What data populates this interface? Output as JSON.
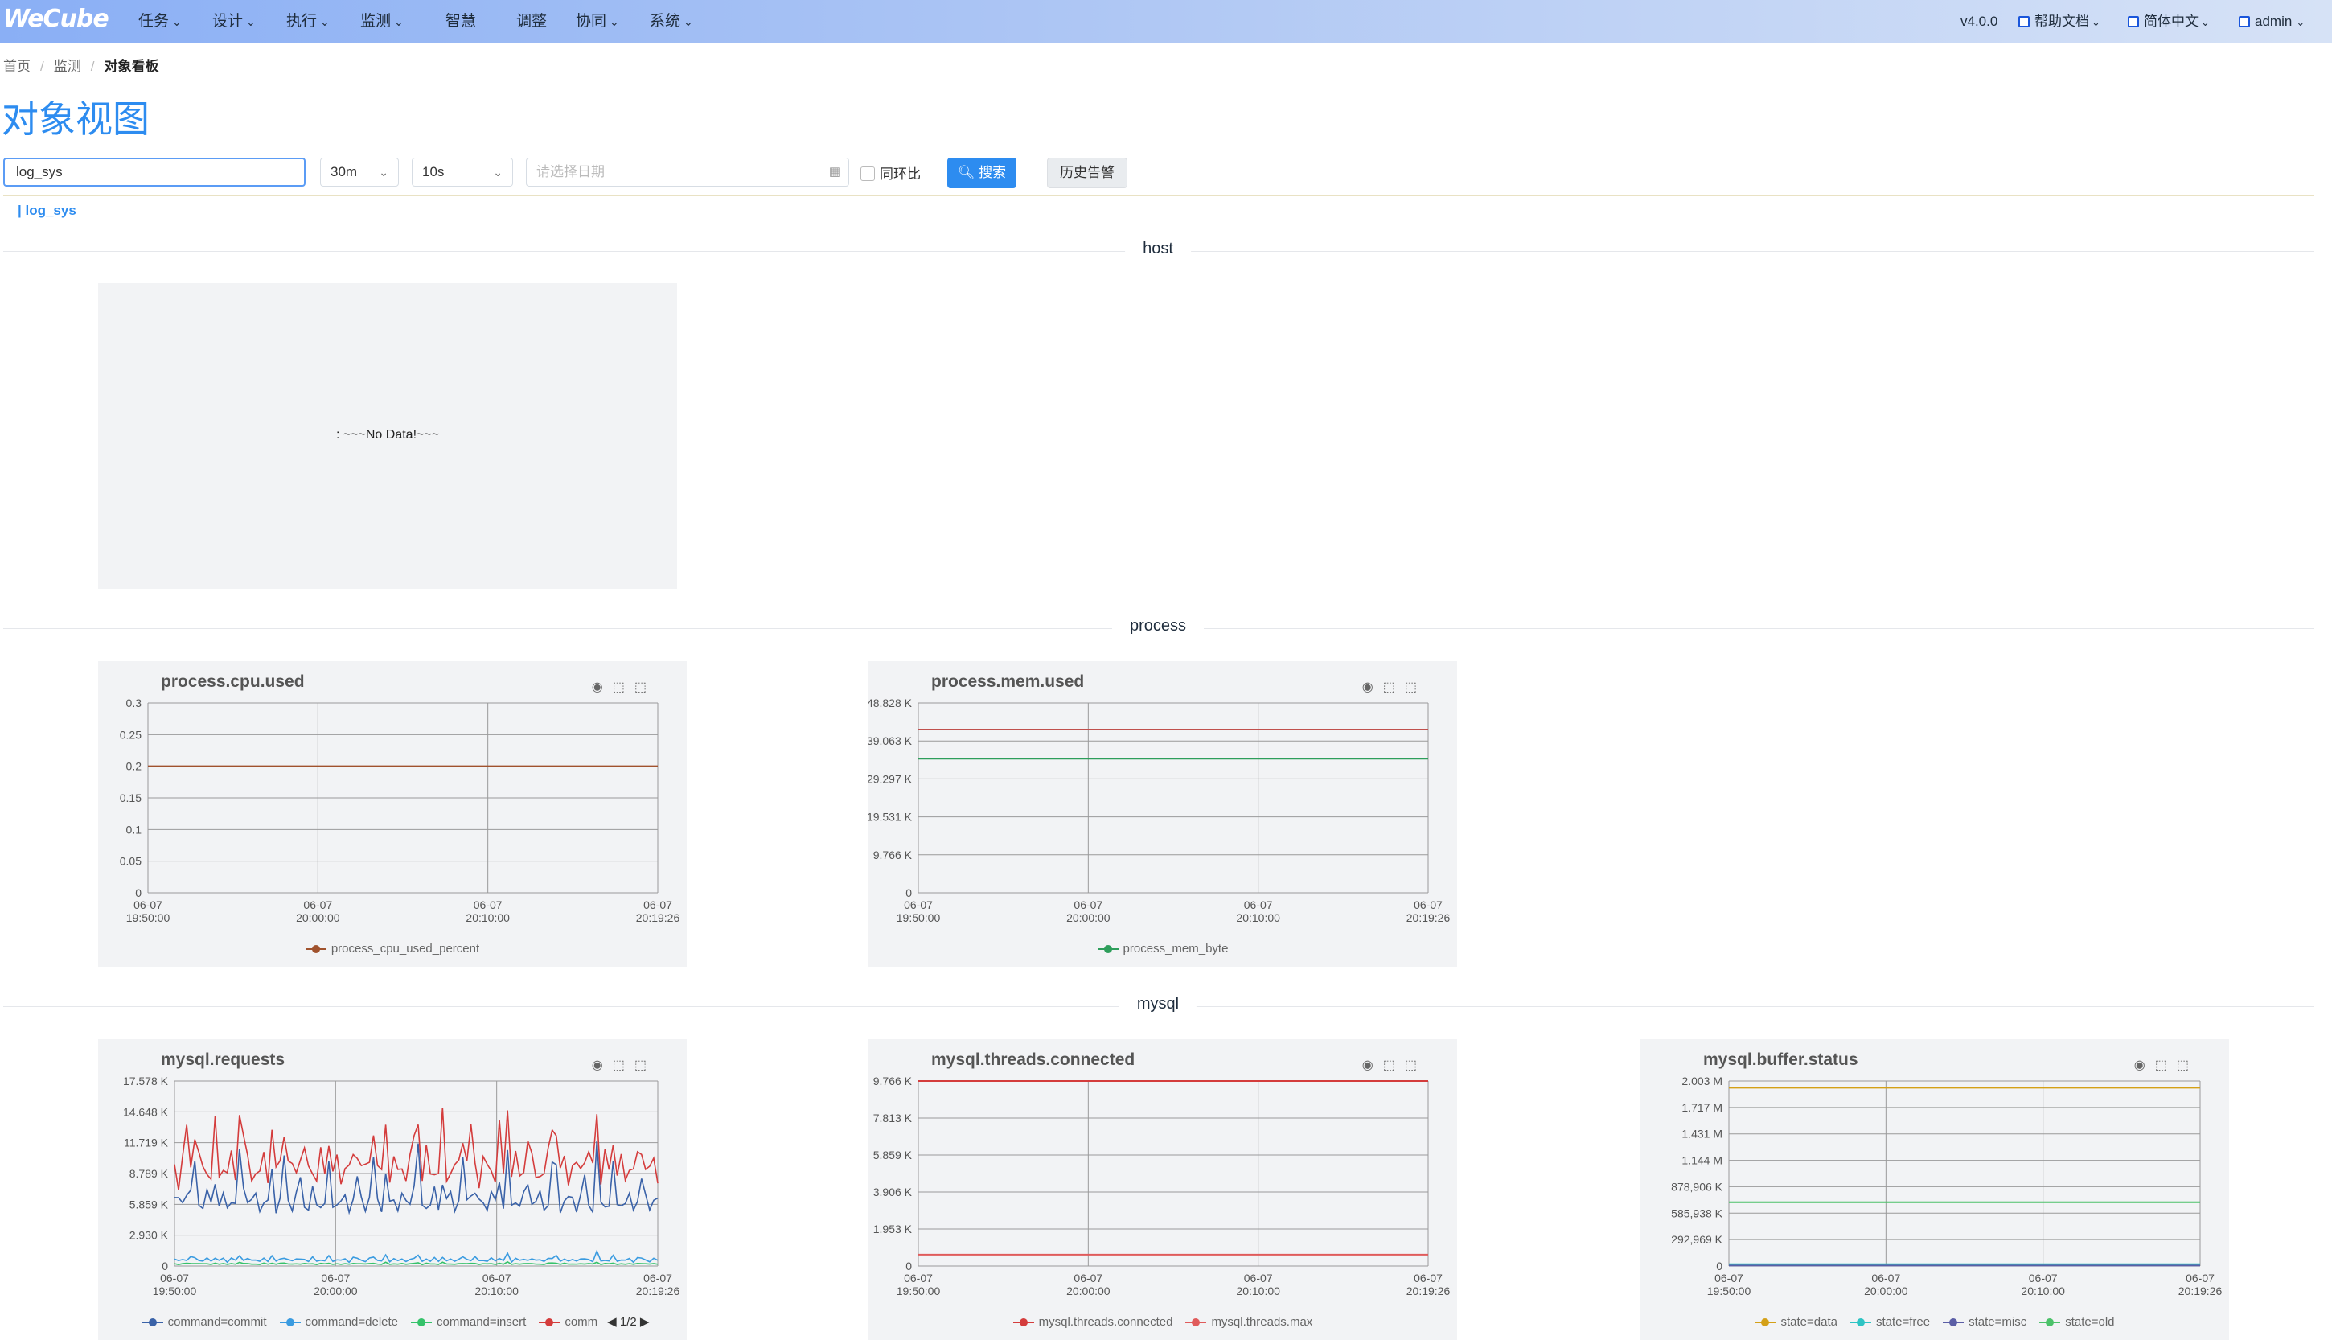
{
  "topbar": {
    "logo": "WeCube",
    "menus": [
      "任务",
      "设计",
      "执行",
      "监测",
      "智慧",
      "调整",
      "协同",
      "系统"
    ],
    "version": "v4.0.0",
    "help": "帮助文档",
    "language": "简体中文",
    "user": "admin"
  },
  "breadcrumb": {
    "home": "首页",
    "section": "监测",
    "current": "对象看板"
  },
  "page": {
    "title": "对象视图"
  },
  "filters": {
    "object": "log_sys",
    "range": "30m",
    "interval": "10s",
    "date_placeholder": "请选择日期",
    "compare_label": "同环比",
    "search_label": "搜索",
    "history_label": "历史告警"
  },
  "tag": "| log_sys",
  "groups": {
    "host": "host",
    "process": "process",
    "mysql": "mysql"
  },
  "no_data": ": ~~~No Data!~~~",
  "chart_data": [
    {
      "type": "line",
      "title": "process.cpu.used",
      "x": [
        "06-07\n19:50:00",
        "06-07\n20:00:00",
        "06-07\n20:10:00",
        "06-07\n20:19:26"
      ],
      "y_ticks": [
        "0",
        "0.05",
        "0.1",
        "0.15",
        "0.2",
        "0.25",
        "0.3"
      ],
      "ylim": [
        0,
        0.3
      ],
      "series": [
        {
          "name": "process_cpu_used_percent",
          "values": [
            0.2,
            0.2,
            0.2,
            0.2
          ],
          "color": "#a0522d"
        }
      ]
    },
    {
      "type": "line",
      "title": "process.mem.used",
      "x": [
        "06-07\n19:50:00",
        "06-07\n20:00:00",
        "06-07\n20:10:00",
        "06-07\n20:19:26"
      ],
      "y_ticks": [
        "0",
        "9.766 K",
        "19.531 K",
        "29.297 K",
        "39.063 K",
        "48.828 K"
      ],
      "ylim": [
        0,
        48828
      ],
      "series": [
        {
          "name": "process_mem_byte",
          "values": [
            34500,
            34500,
            34500,
            34500
          ],
          "color": "#2e9e5b"
        },
        {
          "name": "",
          "values": [
            42000,
            42000,
            42000,
            42000
          ],
          "color": "#c0504d"
        }
      ]
    },
    {
      "type": "line",
      "title": "mysql.requests",
      "x": [
        "06-07\n19:50:00",
        "06-07\n20:00:00",
        "06-07\n20:10:00",
        "06-07\n20:19:26"
      ],
      "y_ticks": [
        "0",
        "2.930 K",
        "5.859 K",
        "8.789 K",
        "11.719 K",
        "14.648 K",
        "17.578 K"
      ],
      "ylim": [
        0,
        17578
      ],
      "series": [
        {
          "name": "command=commit",
          "values": [
            6500,
            5800,
            6200,
            5600,
            6800,
            5700,
            6300,
            5900,
            6600,
            5800
          ],
          "color": "#3a62a8"
        },
        {
          "name": "command=delete",
          "values": [
            600,
            500,
            700,
            400,
            800,
            500,
            600,
            450,
            700,
            500
          ],
          "color": "#3a9be0"
        },
        {
          "name": "command=insert",
          "values": [
            200,
            150,
            250,
            180,
            220,
            160,
            240,
            190,
            210,
            170
          ],
          "color": "#35c26a"
        },
        {
          "name": "comm",
          "values": [
            9500,
            8200,
            10300,
            8900,
            9800,
            8400,
            10100,
            8700,
            9600,
            8800
          ],
          "color": "#d43c3c"
        }
      ],
      "legend_pager": "1/2"
    },
    {
      "type": "line",
      "title": "mysql.threads.connected",
      "x": [
        "06-07\n19:50:00",
        "06-07\n20:00:00",
        "06-07\n20:10:00",
        "06-07\n20:19:26"
      ],
      "y_ticks": [
        "0",
        "1.953 K",
        "3.906 K",
        "5.859 K",
        "7.813 K",
        "9.766 K"
      ],
      "ylim": [
        0,
        9766
      ],
      "series": [
        {
          "name": "mysql.threads.connected",
          "values": [
            9766,
            9766,
            9766,
            9766
          ],
          "color": "#d43c3c"
        },
        {
          "name": "mysql.threads.max",
          "values": [
            600,
            600,
            600,
            600
          ],
          "color": "#e05b5b"
        }
      ]
    },
    {
      "type": "line",
      "title": "mysql.buffer.status",
      "x": [
        "06-07\n19:50:00",
        "06-07\n20:00:00",
        "06-07\n20:10:00",
        "06-07\n20:19:26"
      ],
      "y_ticks": [
        "0",
        "292,969 K",
        "585,938 K",
        "878,906 K",
        "1.144 M",
        "1.431 M",
        "1.717 M",
        "2.003 M"
      ],
      "ylim": [
        0,
        2003000
      ],
      "series": [
        {
          "name": "state=data",
          "values": [
            1930000,
            1930000,
            1930000,
            1930000
          ],
          "color": "#d4a017"
        },
        {
          "name": "state=free",
          "values": [
            20000,
            20000,
            20000,
            20000
          ],
          "color": "#2ec4c4"
        },
        {
          "name": "state=misc",
          "values": [
            5000,
            5000,
            5000,
            5000
          ],
          "color": "#5b5ea6"
        },
        {
          "name": "state=old",
          "values": [
            690000,
            690000,
            690000,
            690000
          ],
          "color": "#4cc26a"
        }
      ]
    }
  ]
}
